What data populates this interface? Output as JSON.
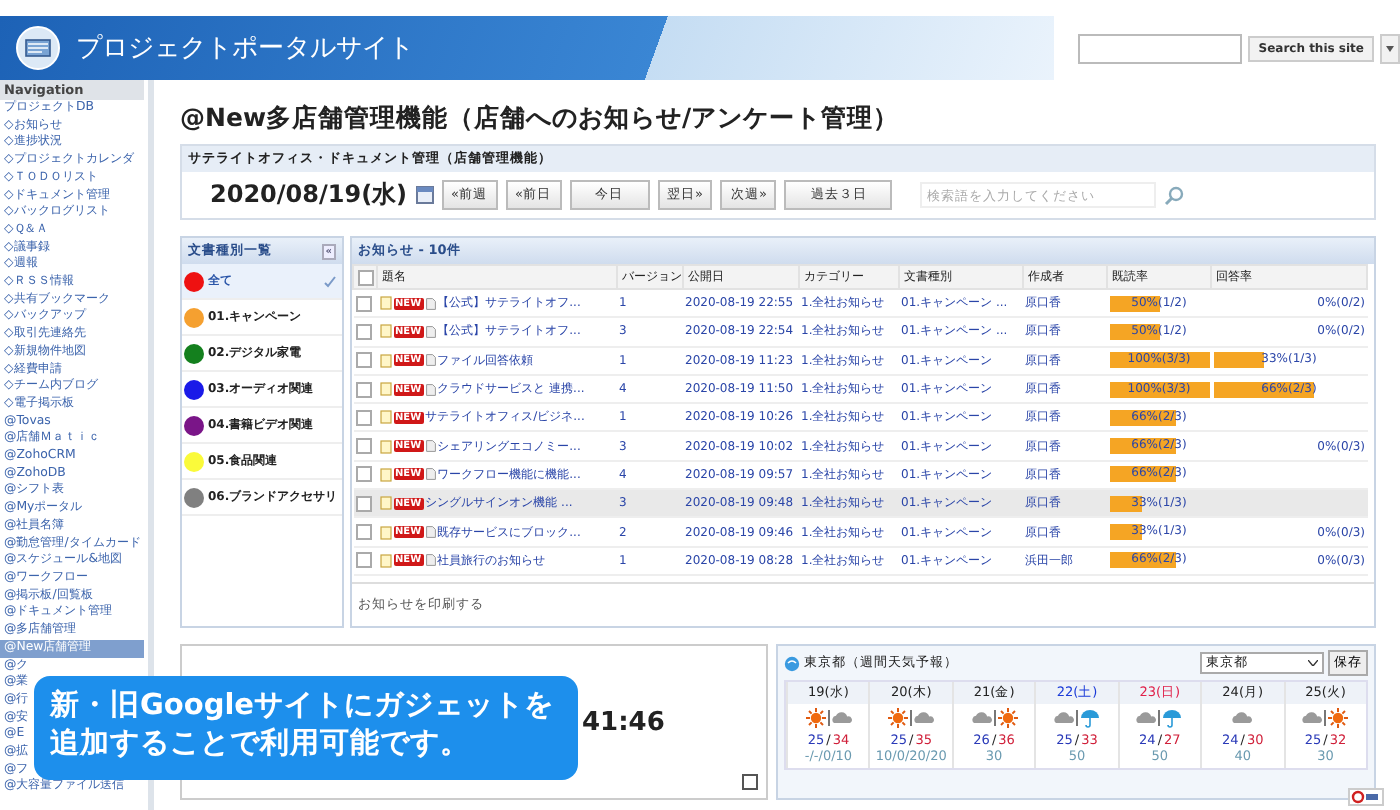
{
  "header": {
    "title": "プロジェクトポータルサイト",
    "search_button": "Search this site"
  },
  "sidebar": {
    "heading": "Navigation",
    "items": [
      {
        "label": "プロジェクトDB",
        "selected": false
      },
      {
        "label": "◇お知らせ",
        "selected": false
      },
      {
        "label": "◇進捗状況",
        "selected": false
      },
      {
        "label": "◇プロジェクトカレンダ",
        "selected": false
      },
      {
        "label": "◇ＴＯＤＯリスト",
        "selected": false
      },
      {
        "label": "◇ドキュメント管理",
        "selected": false
      },
      {
        "label": "◇バックログリスト",
        "selected": false
      },
      {
        "label": "◇Ｑ＆Ａ",
        "selected": false
      },
      {
        "label": "◇議事録",
        "selected": false
      },
      {
        "label": "◇週報",
        "selected": false
      },
      {
        "label": "◇ＲＳＳ情報",
        "selected": false
      },
      {
        "label": "◇共有ブックマーク",
        "selected": false
      },
      {
        "label": "◇バックアップ",
        "selected": false
      },
      {
        "label": "◇取引先連絡先",
        "selected": false
      },
      {
        "label": "◇新規物件地図",
        "selected": false
      },
      {
        "label": "◇経費申請",
        "selected": false
      },
      {
        "label": "◇チーム内ブログ",
        "selected": false
      },
      {
        "label": "◇電子掲示板",
        "selected": false
      },
      {
        "label": "@Tovas",
        "selected": false
      },
      {
        "label": "@店舗Ｍａｔｉｃ",
        "selected": false
      },
      {
        "label": "@ZohoCRM",
        "selected": false
      },
      {
        "label": "@ZohoDB",
        "selected": false
      },
      {
        "label": "@シフト表",
        "selected": false
      },
      {
        "label": "@Myポータル",
        "selected": false
      },
      {
        "label": "@社員名簿",
        "selected": false
      },
      {
        "label": "@勤怠管理/タイムカード",
        "selected": false
      },
      {
        "label": "@スケジュール&地図",
        "selected": false
      },
      {
        "label": "@ワークフロー",
        "selected": false
      },
      {
        "label": "@掲示板/回覧板",
        "selected": false
      },
      {
        "label": "@ドキュメント管理",
        "selected": false
      },
      {
        "label": "@多店舗管理",
        "selected": false
      },
      {
        "label": "@New店舗管理",
        "selected": true
      },
      {
        "label": "@ク",
        "selected": false
      },
      {
        "label": "@業",
        "selected": false
      },
      {
        "label": "@行",
        "selected": false
      },
      {
        "label": "@安",
        "selected": false
      },
      {
        "label": "@E",
        "selected": false
      },
      {
        "label": "@拡",
        "selected": false
      },
      {
        "label": "@フ",
        "selected": false
      },
      {
        "label": "@大容量ファイル送信",
        "selected": false
      }
    ]
  },
  "page_title": "@New多店舗管理機能（店舗へのお知らせ/アンケート管理）",
  "module": {
    "title": "サテライトオフィス・ドキュメント管理（店舗管理機能）",
    "date": "2020/08/19(水)",
    "nav_buttons": [
      "«前週",
      "«前日",
      "今日",
      "翌日»",
      "次週»",
      "過去３日"
    ],
    "search": {
      "placeholder": "検索語を入力してください"
    }
  },
  "doc_types": {
    "title": "文書種別一覧",
    "collapse": "«",
    "items": [
      {
        "label": "全て",
        "color": "#ee1111",
        "selected": true
      },
      {
        "label": "01.キャンペーン",
        "color": "#f5a030",
        "selected": false
      },
      {
        "label": "02.デジタル家電",
        "color": "#14801e",
        "selected": false
      },
      {
        "label": "03.オーディオ関連",
        "color": "#1a1ae8",
        "selected": false
      },
      {
        "label": "04.書籍ビデオ関連",
        "color": "#7a1588",
        "selected": false
      },
      {
        "label": "05.食品関連",
        "color": "#fafa3a",
        "selected": false
      },
      {
        "label": "06.ブランドアクセサリ",
        "color": "#808080",
        "selected": false
      }
    ]
  },
  "notices": {
    "title": "お知らせ - 10件",
    "select_all_checked": false,
    "columns": [
      "題名",
      "バージョン",
      "公開日",
      "カテゴリー",
      "文書種別",
      "作成者",
      "既読率",
      "回答率"
    ],
    "rows": [
      {
        "new_badge": "NEW",
        "attachment": true,
        "title": "【公式】サテライトオフ...",
        "version": "1",
        "date": "2020-08-19 22:55",
        "category": "1.全社お知らせ",
        "doc_type": "01.キャンペーン ...",
        "author": "原口香",
        "read": {
          "text": "50%(1/2)",
          "level": 0.5
        },
        "answer": {
          "text": "0%(0/2)"
        },
        "selected": false
      },
      {
        "new_badge": "NEW",
        "attachment": true,
        "title": "【公式】サテライトオフ...",
        "version": "3",
        "date": "2020-08-19 22:54",
        "category": "1.全社お知らせ",
        "doc_type": "01.キャンペーン ...",
        "author": "原口香",
        "read": {
          "text": "50%(1/2)",
          "level": 0.5
        },
        "answer": {
          "text": "0%(0/2)"
        },
        "selected": false
      },
      {
        "new_badge": "NEW",
        "attachment": true,
        "title": "ファイル回答依頼",
        "version": "1",
        "date": "2020-08-19 11:23",
        "category": "1.全社お知らせ",
        "doc_type": "01.キャンペーン",
        "author": "原口香",
        "read": {
          "text": "100%(3/3)",
          "level": 1
        },
        "answer": {
          "text": "33%(1/3)",
          "level": 0.33
        },
        "selected": false
      },
      {
        "new_badge": "NEW",
        "attachment": true,
        "title": "クラウドサービスと 連携...",
        "version": "4",
        "date": "2020-08-19 11:50",
        "category": "1.全社お知らせ",
        "doc_type": "01.キャンペーン",
        "author": "原口香",
        "read": {
          "text": "100%(3/3)",
          "level": 1
        },
        "answer": {
          "text": "66%(2/3)",
          "level": 0.66
        },
        "selected": false
      },
      {
        "new_badge": "NEW",
        "attachment": false,
        "title": "サテライトオフィス/ビジネ...",
        "version": "1",
        "date": "2020-08-19 10:26",
        "category": "1.全社お知らせ",
        "doc_type": "01.キャンペーン",
        "author": "原口香",
        "read": {
          "text": "66%(2/3)",
          "level": 0.66
        },
        "selected": false
      },
      {
        "new_badge": "NEW",
        "attachment": true,
        "title": "シェアリングエコノミー...",
        "version": "3",
        "date": "2020-08-19 10:02",
        "category": "1.全社お知らせ",
        "doc_type": "01.キャンペーン",
        "author": "原口香",
        "read": {
          "text": "66%(2/3)",
          "level": 0.66
        },
        "answer": {
          "text": "0%(0/3)"
        },
        "selected": false
      },
      {
        "new_badge": "NEW",
        "attachment": true,
        "title": "ワークフロー機能に機能...",
        "version": "4",
        "date": "2020-08-19 09:57",
        "category": "1.全社お知らせ",
        "doc_type": "01.キャンペーン",
        "author": "原口香",
        "read": {
          "text": "66%(2/3)",
          "level": 0.66
        },
        "selected": false
      },
      {
        "new_badge": "NEW",
        "attachment": false,
        "title": "シングルサインオン機能 ...",
        "version": "3",
        "date": "2020-08-19 09:48",
        "category": "1.全社お知らせ",
        "doc_type": "01.キャンペーン",
        "author": "原口香",
        "read": {
          "text": "33%(1/3)",
          "level": 0.33
        },
        "selected": true
      },
      {
        "new_badge": "NEW",
        "attachment": true,
        "title": "既存サービスにブロック...",
        "version": "2",
        "date": "2020-08-19 09:46",
        "category": "1.全社お知らせ",
        "doc_type": "01.キャンペーン",
        "author": "原口香",
        "read": {
          "text": "33%(1/3)",
          "level": 0.33
        },
        "answer": {
          "text": "0%(0/3)"
        },
        "selected": false
      },
      {
        "new_badge": "NEW",
        "attachment": true,
        "title": "社員旅行のお知らせ",
        "version": "1",
        "date": "2020-08-19 08:28",
        "category": "1.全社お知らせ",
        "doc_type": "01.キャンペーン",
        "author": "浜田一郎",
        "read": {
          "text": "66%(2/3)",
          "level": 0.66
        },
        "answer": {
          "text": "0%(0/3)"
        },
        "selected": false
      }
    ],
    "print_link": "お知らせを印刷する"
  },
  "clock": {
    "time": "41:46",
    "checked": false
  },
  "weather": {
    "title": "東京都（週間天気予報）",
    "region": "東京都",
    "save_button": "保存",
    "days": [
      {
        "label": "19(水)",
        "kind": "weekday",
        "icons": [
          {
            "kind": "sun"
          },
          {
            "kind": "cloud"
          }
        ],
        "low": "25",
        "slash": "/",
        "high": "34",
        "rain": "-/-/0/10"
      },
      {
        "label": "20(木)",
        "kind": "weekday",
        "icons": [
          {
            "kind": "sun"
          },
          {
            "kind": "cloud"
          }
        ],
        "low": "25",
        "slash": "/",
        "high": "35",
        "rain": "10/0/20/20"
      },
      {
        "label": "21(金)",
        "kind": "weekday",
        "icons": [
          {
            "kind": "cloud"
          },
          {
            "kind": "sun"
          }
        ],
        "low": "26",
        "slash": "/",
        "high": "36",
        "rain": "30"
      },
      {
        "label": "22(土)",
        "kind": "saturday",
        "icons": [
          {
            "kind": "cloud"
          },
          {
            "kind": "umbrella"
          }
        ],
        "low": "25",
        "slash": "/",
        "high": "33",
        "rain": "50"
      },
      {
        "label": "23(日)",
        "kind": "sunday",
        "icons": [
          {
            "kind": "cloud"
          },
          {
            "kind": "umbrella"
          }
        ],
        "low": "24",
        "slash": "/",
        "high": "27",
        "rain": "50"
      },
      {
        "label": "24(月)",
        "kind": "weekday",
        "icons": [
          {
            "kind": "cloud"
          }
        ],
        "low": "24",
        "slash": "/",
        "high": "30",
        "rain": "40"
      },
      {
        "label": "25(火)",
        "kind": "weekday",
        "icons": [
          {
            "kind": "cloud"
          },
          {
            "kind": "sun"
          }
        ],
        "low": "25",
        "slash": "/",
        "high": "32",
        "rain": "30"
      }
    ]
  },
  "callout": {
    "text": "新・旧Googleサイトにガジェットを追加することで利用可能です。"
  }
}
